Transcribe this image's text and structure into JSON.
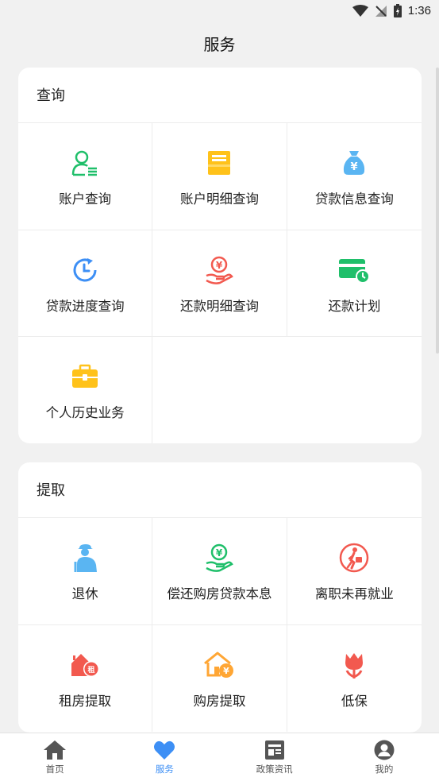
{
  "status": {
    "time": "1:36"
  },
  "header": {
    "title": "服务"
  },
  "sections": {
    "query": {
      "title": "查询",
      "items": [
        {
          "label": "账户查询",
          "icon": "account-user-icon"
        },
        {
          "label": "账户明细查询",
          "icon": "account-detail-icon"
        },
        {
          "label": "贷款信息查询",
          "icon": "money-bag-icon"
        },
        {
          "label": "贷款进度查询",
          "icon": "clock-progress-icon"
        },
        {
          "label": "还款明细查询",
          "icon": "repayment-hand-icon"
        },
        {
          "label": "还款计划",
          "icon": "card-clock-icon"
        },
        {
          "label": "个人历史业务",
          "icon": "briefcase-icon"
        }
      ]
    },
    "withdraw": {
      "title": "提取",
      "items": [
        {
          "label": "退休",
          "icon": "elder-person-icon"
        },
        {
          "label": "偿还购房贷款本息",
          "icon": "coin-hand-icon"
        },
        {
          "label": "离职未再就业",
          "icon": "walking-person-icon"
        },
        {
          "label": "租房提取",
          "icon": "rent-house-icon"
        },
        {
          "label": "购房提取",
          "icon": "buy-house-icon"
        },
        {
          "label": "低保",
          "icon": "tulip-icon"
        }
      ]
    }
  },
  "nav": {
    "items": [
      {
        "label": "首页",
        "icon": "home-icon"
      },
      {
        "label": "服务",
        "icon": "heart-icon"
      },
      {
        "label": "政策资讯",
        "icon": "news-icon"
      },
      {
        "label": "我的",
        "icon": "profile-icon"
      }
    ],
    "active": "服务"
  },
  "colors": {
    "green": "#1fbf6a",
    "yellow": "#ffc21a",
    "blue": "#3d8ff5",
    "light_blue": "#5ab5f2",
    "red": "#f2594f",
    "orange": "#ffa634"
  }
}
